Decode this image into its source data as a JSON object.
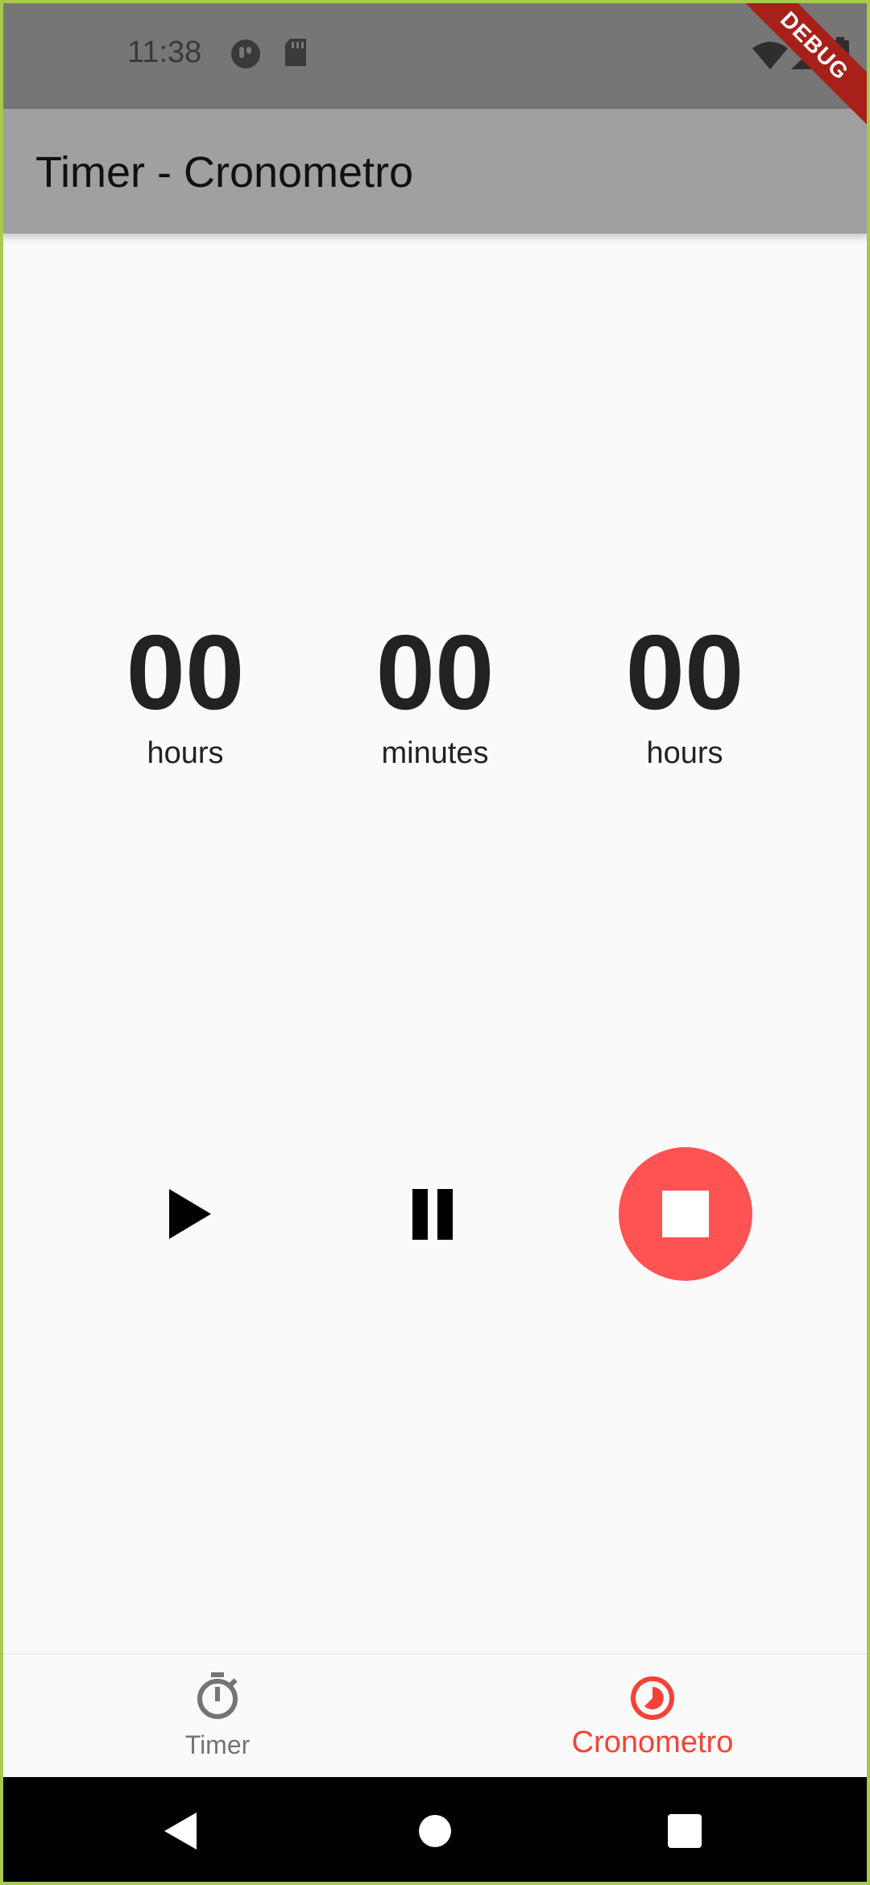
{
  "status_bar": {
    "time": "11:38",
    "icons": [
      "notification-app-icon",
      "sd-card-icon",
      "wifi-icon",
      "cell-signal-icon",
      "battery-icon"
    ]
  },
  "debug_banner": "DEBUG",
  "app_bar": {
    "title": "Timer - Cronometro"
  },
  "timer": {
    "units": [
      {
        "value": "00",
        "label": "hours"
      },
      {
        "value": "00",
        "label": "minutes"
      },
      {
        "value": "00",
        "label": "hours"
      }
    ]
  },
  "controls": {
    "icons": [
      "play-icon",
      "pause-icon",
      "stop-icon"
    ],
    "stop_color": "#ff5252"
  },
  "bottom_nav": {
    "items": [
      {
        "label": "Timer",
        "icon": "stopwatch-icon",
        "selected": false
      },
      {
        "label": "Cronometro",
        "icon": "timelapse-icon",
        "selected": true
      }
    ],
    "active_color": "#f44336",
    "inactive_color": "#757575"
  },
  "system_nav": {
    "icons": [
      "back-icon",
      "home-icon",
      "recents-icon"
    ]
  }
}
